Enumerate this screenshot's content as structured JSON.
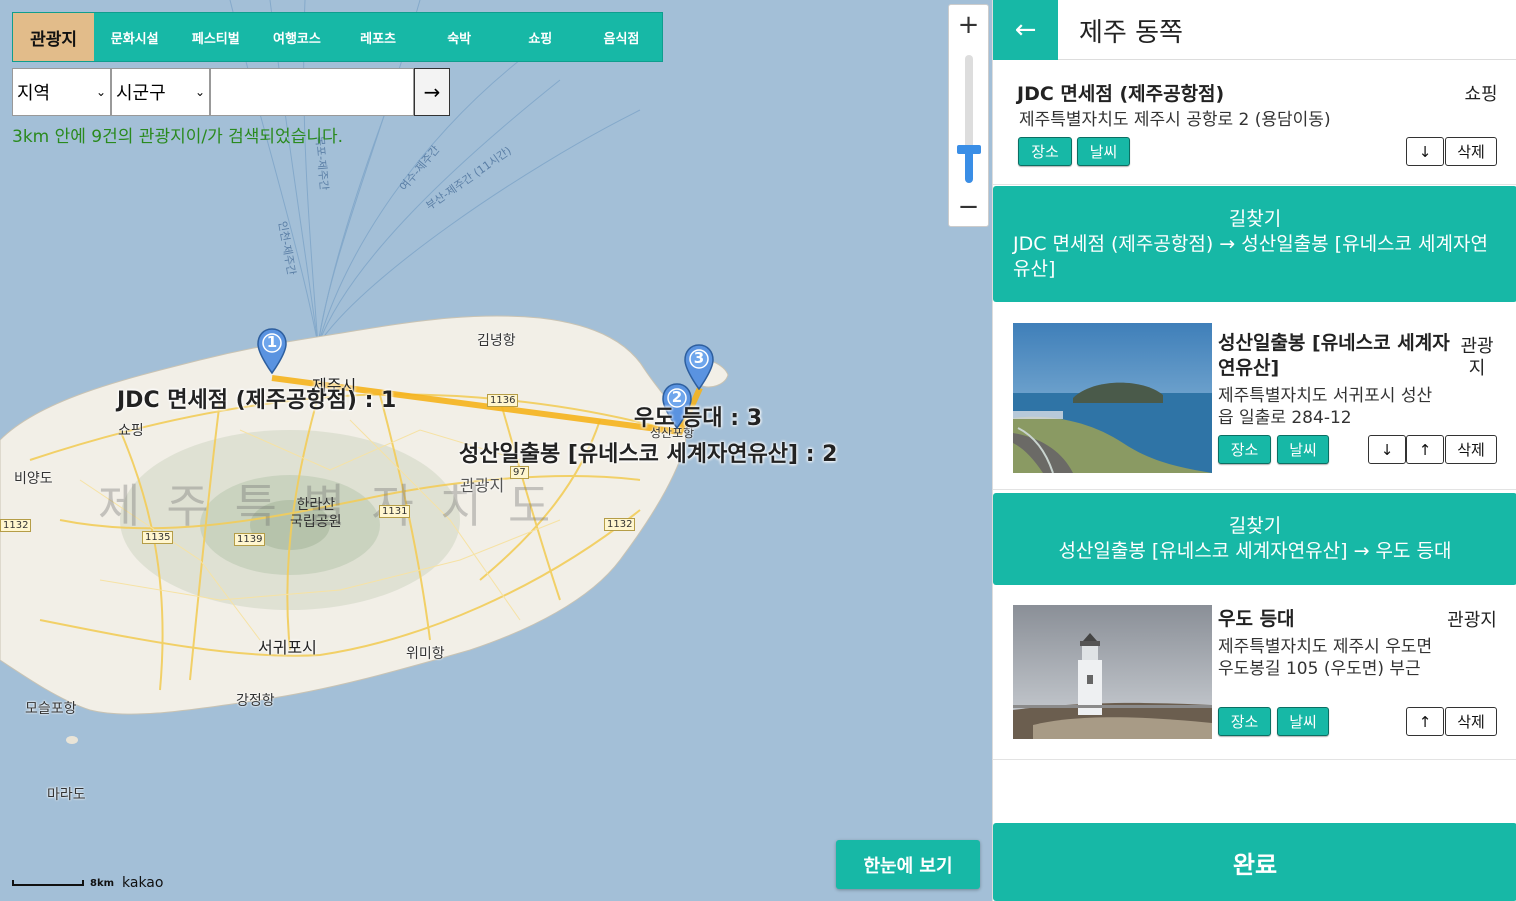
{
  "categories": [
    {
      "label": "관광지",
      "active": true
    },
    {
      "label": "문화시설"
    },
    {
      "label": "페스티벌"
    },
    {
      "label": "여행코스"
    },
    {
      "label": "레포츠"
    },
    {
      "label": "숙박"
    },
    {
      "label": "쇼핑"
    },
    {
      "label": "음식점"
    }
  ],
  "search": {
    "region_select": "지역",
    "district_select": "시군구",
    "input_value": "",
    "go_label": "→",
    "result_text": "3km 안에 9건의 관광지이/가 검색되었습니다."
  },
  "zoom": {
    "plus": "+",
    "minus": "−"
  },
  "map": {
    "province": "제주특별자치도",
    "province_chars": [
      "제",
      "주",
      "특",
      "별",
      "자",
      "치",
      "도"
    ],
    "labels": {
      "gimnyeong": "김녕항",
      "jeju_city": "제주시",
      "shopping": "쇼핑",
      "biyangdo": "비양도",
      "hallasan": "한라산\n국립공원",
      "seogwipo": "서귀포시",
      "wimi": "위미항",
      "gangjeong": "강정항",
      "moseulpo": "모슬포항",
      "marado": "마라도",
      "tourist": "관광지",
      "seongsan_port": "성산포항",
      "udo": "우도"
    },
    "routes": [
      "인천-제주간",
      "여수-제주간",
      "부산-제주간 (11시간)",
      "목포-제주간"
    ],
    "road_numbers": [
      "1136",
      "1131",
      "1135",
      "1139",
      "1132",
      "1132",
      "97"
    ],
    "markers": [
      {
        "num": "1",
        "label": "JDC 면세점 (제주공항점) : 1"
      },
      {
        "num": "2",
        "label": "성산일출봉 [유네스코 세계자연유산] : 2"
      },
      {
        "num": "3",
        "label": "우도 등대 : 3"
      }
    ],
    "scale_text": "8km",
    "brand": "kakao"
  },
  "overview_button": "한눈에 보기",
  "panel": {
    "back": "←",
    "title": "제주 동쪽",
    "places": [
      {
        "name": "JDC 면세점 (제주공항점)",
        "category": "쇼핑",
        "address": "제주특별자치도 제주시 공항로 2 (용담이동)",
        "btn_place": "장소",
        "btn_weather": "날씨",
        "btn_down": "↓",
        "btn_delete": "삭제"
      },
      {
        "name": "성산일출봉 [유네스코 세계자연유산]",
        "category": "관광지",
        "address": "제주특별자치도 서귀포시 성산읍 일출로 284-12",
        "btn_place": "장소",
        "btn_weather": "날씨",
        "btn_down": "↓",
        "btn_up": "↑",
        "btn_delete": "삭제"
      },
      {
        "name": "우도 등대",
        "category": "관광지",
        "address": "제주특별자치도 제주시 우도면 우도봉길 105 (우도면) 부근",
        "btn_place": "장소",
        "btn_weather": "날씨",
        "btn_up": "↑",
        "btn_delete": "삭제"
      }
    ],
    "directions": [
      {
        "title": "길찾기",
        "route": "JDC 면세점 (제주공항점) → 성산일출봉 [유네스코 세계자연유산]"
      },
      {
        "title": "길찾기",
        "route": "성산일출봉 [유네스코 세계자연유산] → 우도 등대"
      }
    ],
    "done": "완료"
  },
  "colors": {
    "accent": "#17b8a6",
    "active_tab": "#e2bc8a",
    "result_text": "#2a8a1e",
    "route_line": "#f5b21c"
  }
}
